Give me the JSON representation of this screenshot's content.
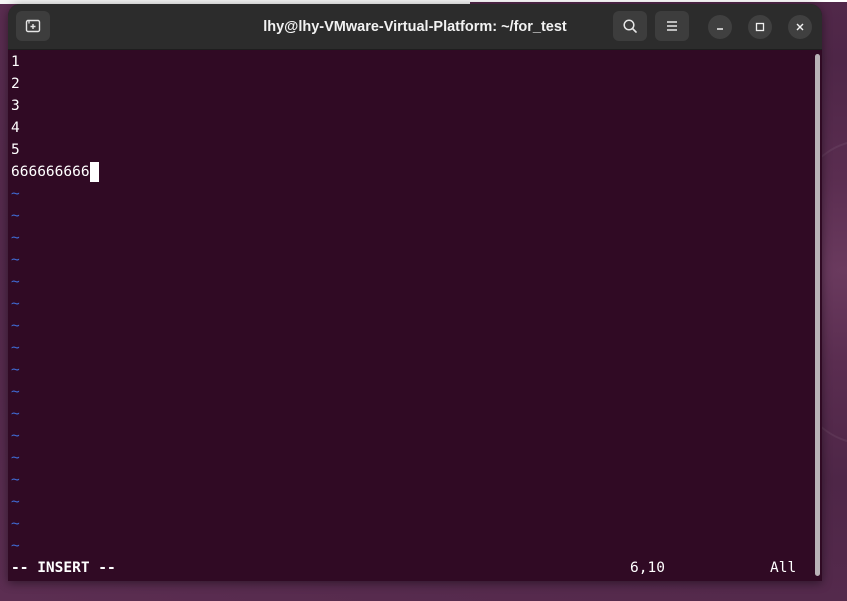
{
  "window": {
    "title": "lhy@lhy-VMware-Virtual-Platform: ~/for_test"
  },
  "titlebar": {
    "new_tab_icon": "new-tab-icon",
    "search_icon": "search-icon",
    "menu_icon": "hamburger-menu-icon",
    "minimize_icon": "minimize-icon",
    "maximize_icon": "maximize-icon",
    "close_icon": "close-icon"
  },
  "editor": {
    "lines": [
      "1",
      "2",
      "3",
      "4",
      "5",
      "666666666"
    ],
    "tilde": "~",
    "tilde_count": 17,
    "mode": "-- INSERT --",
    "position": "6,10",
    "scroll": "All"
  },
  "colors": {
    "terminal_bg": "#300a24",
    "tilde": "#3f6bd3",
    "titlebar_bg": "#2c2c2c"
  }
}
